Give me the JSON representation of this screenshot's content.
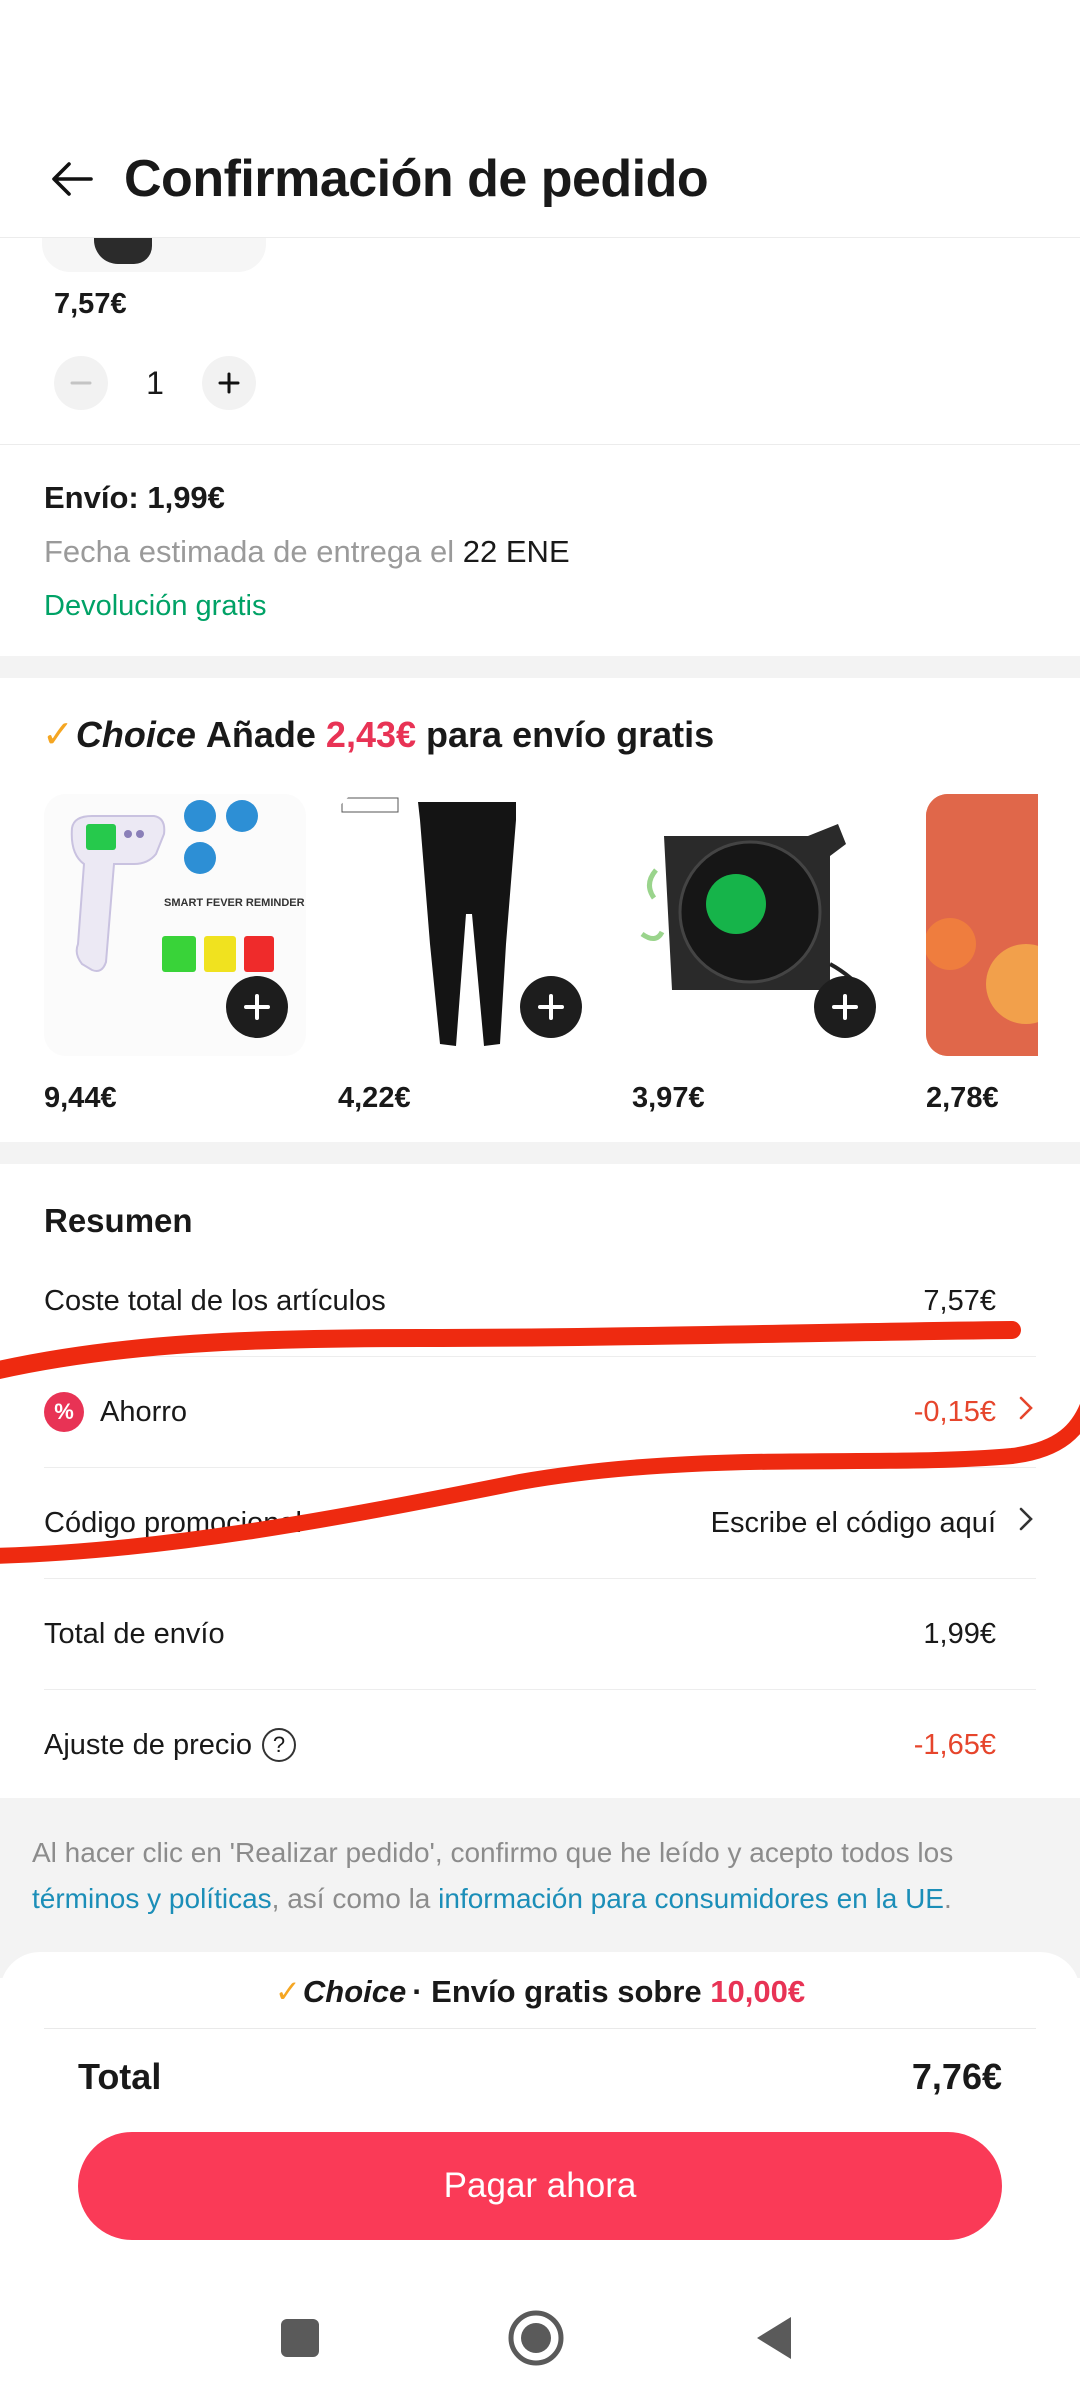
{
  "header": {
    "title": "Confirmación de pedido",
    "back_icon": "arrow-left-icon"
  },
  "product": {
    "price": "7,57€",
    "quantity": "1",
    "minus_label": "−",
    "plus_label": "+"
  },
  "shipping": {
    "title": "Envío: 1,99€",
    "date_prefix": "Fecha estimada de entrega el",
    "date_value": "22 ENE",
    "free_return": "Devolución gratis"
  },
  "choice_promo": {
    "brand": "Choice",
    "text_before": "Añade",
    "amount": "2,43€",
    "text_after": "para envío gratis",
    "products": [
      {
        "price": "9,44€",
        "image": "thermometer-image"
      },
      {
        "price": "4,22€",
        "image": "leggings-image"
      },
      {
        "price": "3,97€",
        "image": "usb-fan-image"
      },
      {
        "price": "2,78€",
        "image": "orange-product-image"
      }
    ]
  },
  "summary": {
    "title": "Resumen",
    "items_total_label": "Coste total de los artículos",
    "items_total_value": "7,57€",
    "saving_label": "Ahorro",
    "saving_value": "-0,15€",
    "promo_label": "Código promocional",
    "promo_placeholder": "Escribe el código aquí",
    "shipping_label": "Total de envío",
    "shipping_value": "1,99€",
    "adjust_label": "Ajuste de precio",
    "adjust_value": "-1,65€"
  },
  "legal": {
    "text1": "Al hacer clic en 'Realizar pedido', confirmo que he leído y acepto todos los ",
    "link1": "términos y políticas",
    "text2": ", así como la ",
    "link2": "información para consumidores en la UE",
    "text3": "."
  },
  "checkout": {
    "choice_brand": "Choice",
    "free_ship_text": "· Envío gratis sobre",
    "free_ship_amount": "10,00€",
    "total_label": "Total",
    "total_value": "7,76€",
    "pay_label": "Pagar ahora"
  },
  "colors": {
    "accent_red": "#e83355",
    "pay_button": "#fa3a57",
    "green": "#00a266",
    "link": "#1b8eb8",
    "annotation": "#ee2a10"
  }
}
